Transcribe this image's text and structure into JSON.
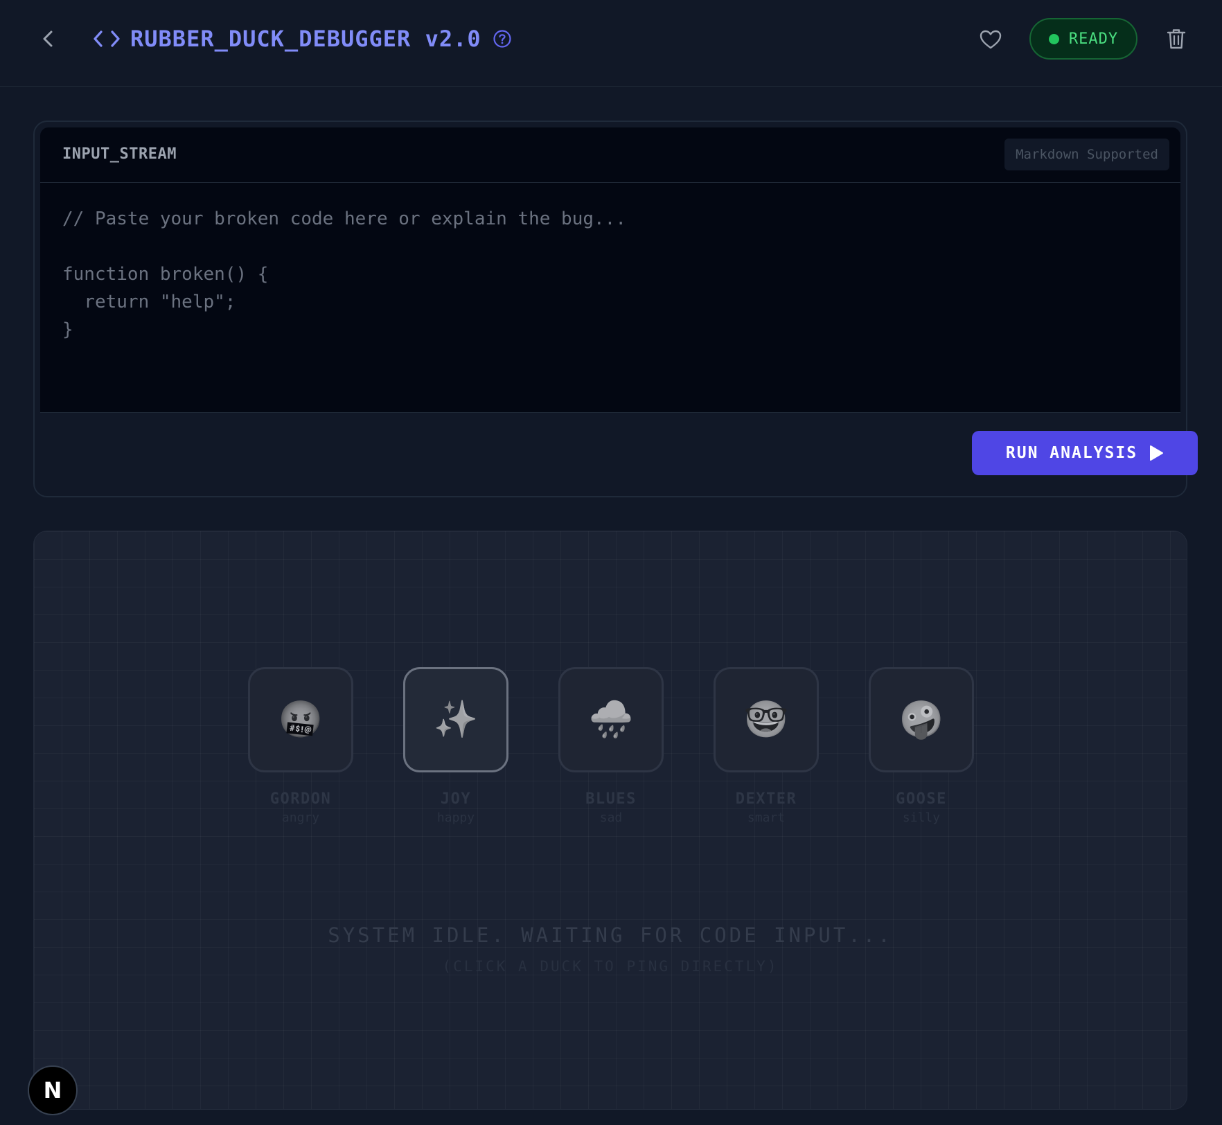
{
  "header": {
    "title": "RUBBER_DUCK_DEBUGGER v2.0",
    "status": "READY"
  },
  "editor": {
    "label": "INPUT_STREAM",
    "badge": "Markdown Supported",
    "content": "// Paste your broken code here or explain the bug...\n\nfunction broken() {\n  return \"help\";\n}",
    "run_label": "RUN ANALYSIS"
  },
  "ducks": [
    {
      "name": "GORDON",
      "mood": "angry",
      "emoji": "🤬"
    },
    {
      "name": "JOY",
      "mood": "happy",
      "emoji": "✨"
    },
    {
      "name": "BLUES",
      "mood": "sad",
      "emoji": "🌧️"
    },
    {
      "name": "DEXTER",
      "mood": "smart",
      "emoji": "🤓"
    },
    {
      "name": "GOOSE",
      "mood": "silly",
      "emoji": "🤪"
    }
  ],
  "idle": {
    "message": "SYSTEM IDLE. WAITING FOR CODE INPUT...",
    "hint": "(CLICK A DUCK TO PING DIRECTLY)"
  },
  "badge": {
    "letter": "N"
  },
  "colors": {
    "accent": "#4f46e5",
    "title": "#818cf8",
    "status_green": "#22c55e",
    "background": "#111827"
  }
}
